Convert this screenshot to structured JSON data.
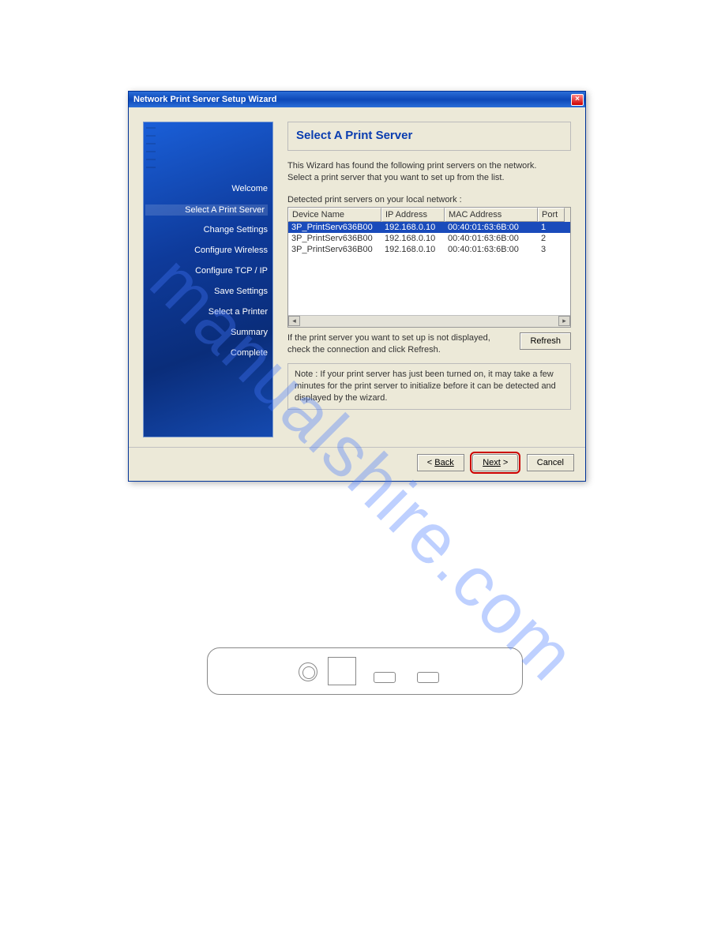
{
  "watermark": "manualshire.com",
  "titlebar": {
    "title": "Network Print Server Setup Wizard"
  },
  "sidebar": {
    "items": [
      {
        "label": "Welcome"
      },
      {
        "label": "Select A Print Server"
      },
      {
        "label": "Change Settings"
      },
      {
        "label": "Configure Wireless"
      },
      {
        "label": "Configure TCP / IP"
      },
      {
        "label": "Save Settings"
      },
      {
        "label": "Select a Printer"
      },
      {
        "label": "Summary"
      },
      {
        "label": "Complete"
      }
    ]
  },
  "main": {
    "heading": "Select A Print Server",
    "instructions_l1": "This Wizard has found the following print servers on the network.",
    "instructions_l2": "Select a print server that you want to set up from the list.",
    "detected_label": "Detected print servers on your local network :",
    "columns": {
      "c0": "Device Name",
      "c1": "IP Address",
      "c2": "MAC Address",
      "c3": "Port"
    },
    "rows": [
      {
        "name": "3P_PrintServ636B00",
        "ip": "192.168.0.10",
        "mac": "00:40:01:63:6B:00",
        "port": "1"
      },
      {
        "name": "3P_PrintServ636B00",
        "ip": "192.168.0.10",
        "mac": "00:40:01:63:6B:00",
        "port": "2"
      },
      {
        "name": "3P_PrintServ636B00",
        "ip": "192.168.0.10",
        "mac": "00:40:01:63:6B:00",
        "port": "3"
      }
    ],
    "refresh_text": "If the print server you want to set up is not displayed, check the connection and click Refresh.",
    "refresh_label": "Refresh",
    "note": "Note : If your print server has just been turned on, it may take a few minutes for the print server to initialize before it can be detected and displayed by the wizard."
  },
  "footer": {
    "back": "Back",
    "next": "Next",
    "cancel": "Cancel"
  }
}
